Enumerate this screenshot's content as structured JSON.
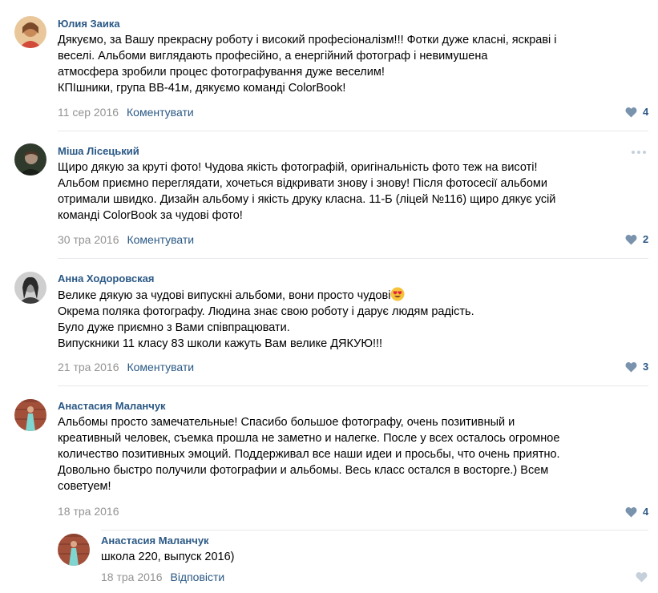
{
  "comments": [
    {
      "author": "Юлия Заика",
      "lines": [
        "Дякуємо, за Вашу прекрасну роботу і високий професіоналізм!!! Фотки дуже класні, яскраві і",
        "веселі. Альбоми виглядають професійно, а енергійний фотограф і невимушена",
        "атмосфера зробили процес фотографування дуже веселим!",
        "КПІшники, група ВВ-41м, дякуємо команді ColorBook!"
      ],
      "date": "11 сер 2016",
      "action": "Коментувати",
      "likes": "4"
    },
    {
      "author": "Міша Лісецький",
      "lines": [
        "Щиро дякую за круті фото! Чудова якість фотографій, оригінальність фото теж на висоті!",
        "Альбом приємно переглядати, хочеться відкривати знову і знову! Після фотосесії альбоми",
        "отримали швидко. Дизайн альбому і якість друку класна. 11-Б (ліцей №116) щиро дякує усій",
        "команді ColorBook за чудові фото!"
      ],
      "date": "30 тра 2016",
      "action": "Коментувати",
      "likes": "2"
    },
    {
      "author": "Анна Ходоровская",
      "lines": [
        "Велике дякую за чудові випускні альбоми, вони просто чудові",
        "Окрема поляка фотографу. Людина знає свою роботу і дарує людям радість.",
        "Було дуже приємно з Вами співпрацювати.",
        "Випускники 11 класу 83 школи кажуть Вам велике ДЯКУЮ!!!"
      ],
      "date": "21 тра 2016",
      "action": "Коментувати",
      "likes": "3"
    },
    {
      "author": "Анастасия Маланчук",
      "lines": [
        "Альбомы просто замечательные! Спасибо большое фотографу, очень позитивный и",
        "креативный человек, съемка прошла не заметно и налегке. После у всех осталось огромное",
        "количество позитивных эмоций. Поддерживал все наши идеи и просьбы, что очень приятно.",
        "Довольно быстро получили фотографии и альбомы. Весь класс остался в восторге.) Всем",
        "советуем!"
      ],
      "date": "18 тра 2016",
      "action": "",
      "likes": "4"
    }
  ],
  "reply": {
    "author": "Анастасия Маланчук",
    "lines": [
      "школа 220, выпуск 2016)"
    ],
    "date": "18 тра 2016",
    "action": "Відповісти",
    "likes": ""
  },
  "icons": {
    "like": "heart-icon",
    "more": "more-options-icon",
    "emoji": "heart-eyes-emoji"
  },
  "colors": {
    "link": "#2a5885",
    "meta": "#939393",
    "like_active": "#7a93ad",
    "like_empty": "#c5d0db",
    "divider": "#e7e8ec"
  }
}
